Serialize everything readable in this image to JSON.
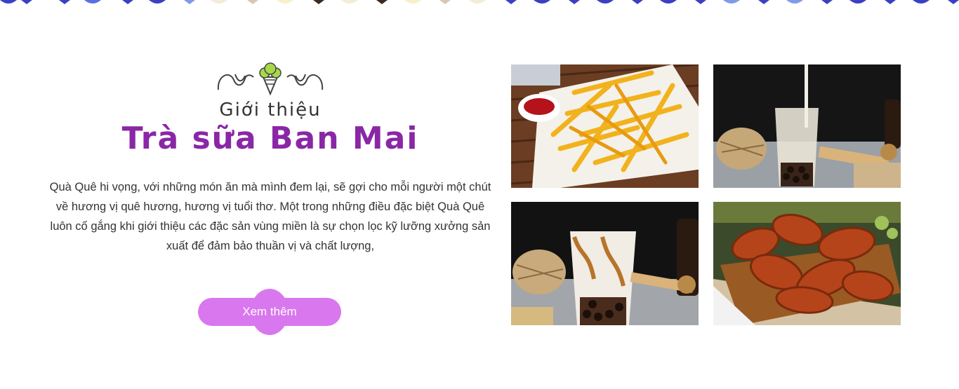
{
  "intro": {
    "subtitle": "Giới thiệu",
    "title": "Trà sữa Ban Mai",
    "description": "Quà Quê hi vọng, với những món ăn mà mình đem lại, sẽ gợi cho mỗi người một chút về hương vị quê hương, hương vị tuổi thơ. Một trong những điều đặc biệt Quà Quê luôn cố gắng khi giới thiệu các đặc sản vùng miền là sự chọn lọc kỹ lưỡng xưởng sản xuất để đảm bảo thuần vị và chất lượng,",
    "button_label": "Xem thêm",
    "ornament_icon": "ice-cream-icon"
  },
  "gallery": {
    "images": [
      {
        "name": "french-fries-photo"
      },
      {
        "name": "milk-tea-pouring-photo"
      },
      {
        "name": "caramel-milk-tea-photo"
      },
      {
        "name": "fried-chicken-wings-photo"
      }
    ]
  },
  "colors": {
    "title": "#8a27a6",
    "button": "#d977ef",
    "border_accent": "#3b3fc4"
  }
}
